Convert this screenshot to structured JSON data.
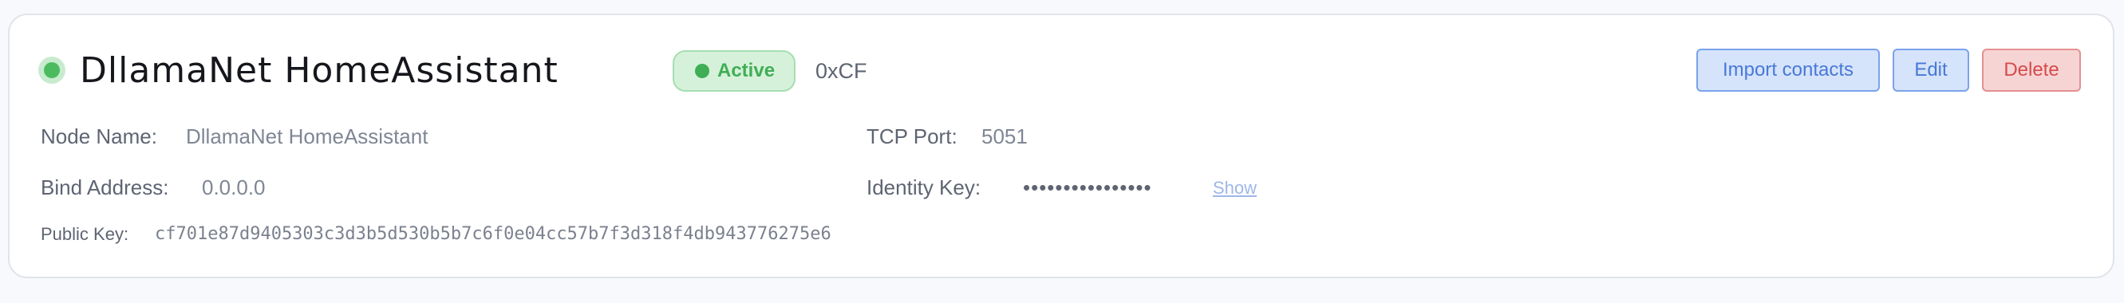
{
  "node": {
    "title": "DllamaNet HomeAssistant",
    "status": "Active",
    "hex_id": "0xCF"
  },
  "actions": {
    "import_label": "Import contacts",
    "edit_label": "Edit",
    "delete_label": "Delete"
  },
  "fields": {
    "node_name_label": "Node Name:",
    "node_name_value": "DllamaNet HomeAssistant",
    "tcp_port_label": "TCP Port:",
    "tcp_port_value": "5051",
    "bind_address_label": "Bind Address:",
    "bind_address_value": "0.0.0.0",
    "identity_key_label": "Identity Key:",
    "identity_key_masked": "••••••••••••••••",
    "show_label": "Show",
    "public_key_label": "Public Key:",
    "public_key_value": "cf701e87d9405303c3d3b5d530b5b7c6f0e04cc57b7f3d318f4db943776275e6"
  },
  "colors": {
    "status_green": "#4cbb5f",
    "action_blue": "#4879d6",
    "action_red": "#d64a4a"
  }
}
